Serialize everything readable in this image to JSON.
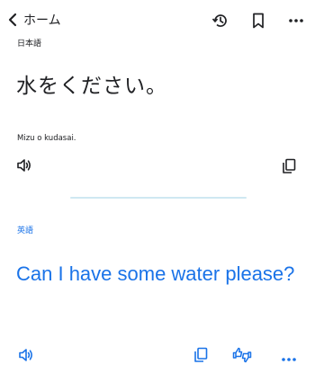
{
  "header": {
    "back_label": "ホーム",
    "icons": [
      "chevron-left-icon",
      "history-icon",
      "bookmark-icon",
      "more-icon"
    ]
  },
  "source": {
    "language": "日本語",
    "text": "水をください。",
    "transliteration": "Mizu o kudasai.",
    "icons": [
      "speaker-icon",
      "copy-icon"
    ]
  },
  "target": {
    "language": "英語",
    "text": "Can I have some water please?",
    "icons": [
      "speaker-icon",
      "copy-icon",
      "feedback-icon",
      "more-icon"
    ]
  },
  "colors": {
    "accent": "#1a73e8",
    "text": "#202124",
    "divider": "#cfe8f2"
  }
}
